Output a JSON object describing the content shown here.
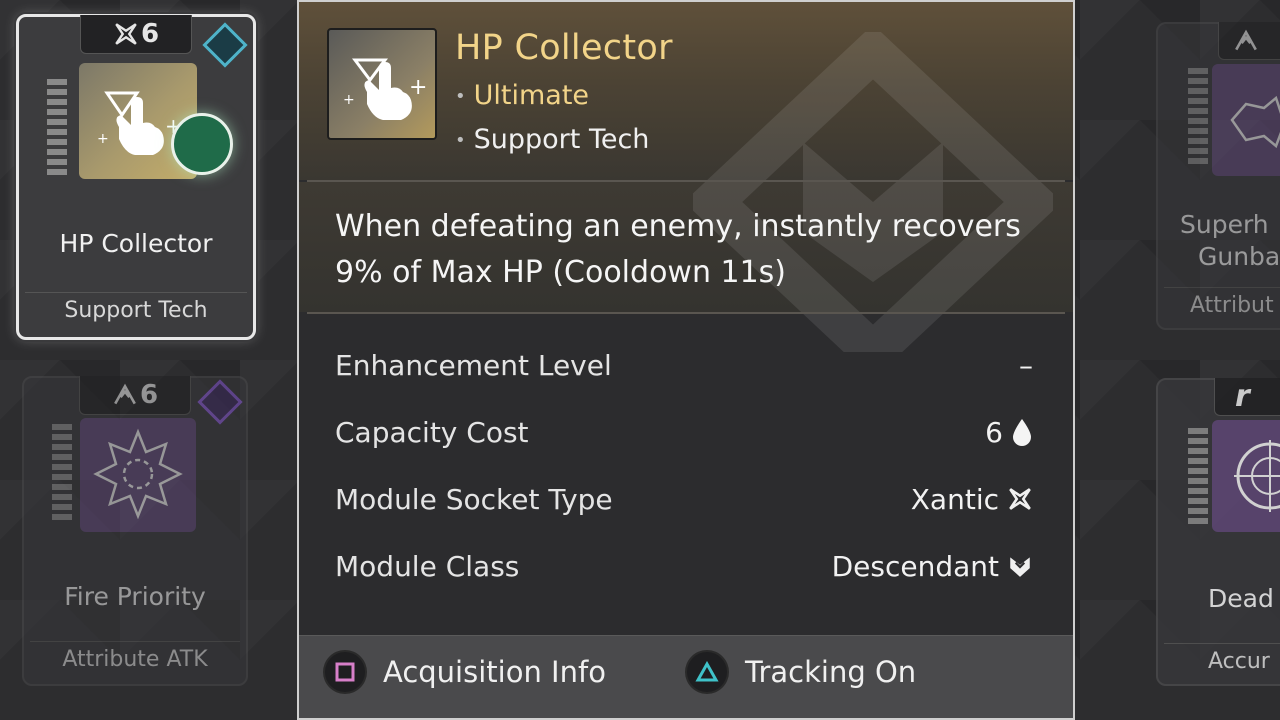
{
  "cards": {
    "selected": {
      "badge": "6",
      "name": "HP Collector",
      "footer": "Support Tech"
    },
    "left_bottom": {
      "badge": "6",
      "name": "Fire Priority",
      "footer": "Attribute ATK"
    },
    "right_top": {
      "name_line1": "Superh",
      "name_line2": "Gunba",
      "footer": "Attribut"
    },
    "right_bottom": {
      "name": "Dead",
      "footer": "Accur"
    }
  },
  "popup": {
    "title": "HP Collector",
    "tags": [
      "Ultimate",
      "Support Tech"
    ],
    "description": "When defeating an enemy, instantly recovers 9% of Max HP (Cooldown 11s)",
    "stats": [
      {
        "label": "Enhancement Level",
        "value": "–",
        "icon": ""
      },
      {
        "label": "Capacity Cost",
        "value": "6",
        "icon": "drop-icon"
      },
      {
        "label": "Module Socket Type",
        "value": "Xantic",
        "icon": "xantic-socket-icon"
      },
      {
        "label": "Module Class",
        "value": "Descendant",
        "icon": "descendant-class-icon"
      }
    ],
    "actions": {
      "acquisition": {
        "label": "Acquisition Info",
        "button_icon": "square-button-icon"
      },
      "tracking": {
        "label": "Tracking On",
        "button_icon": "triangle-button-icon"
      }
    }
  },
  "colors": {
    "title_gold": "#f2d489",
    "square_button": "#d77fc9",
    "triangle_button": "#3fc2c9",
    "purple_accent": "#8a5ad6",
    "teal_accent": "#4fb3c9"
  }
}
